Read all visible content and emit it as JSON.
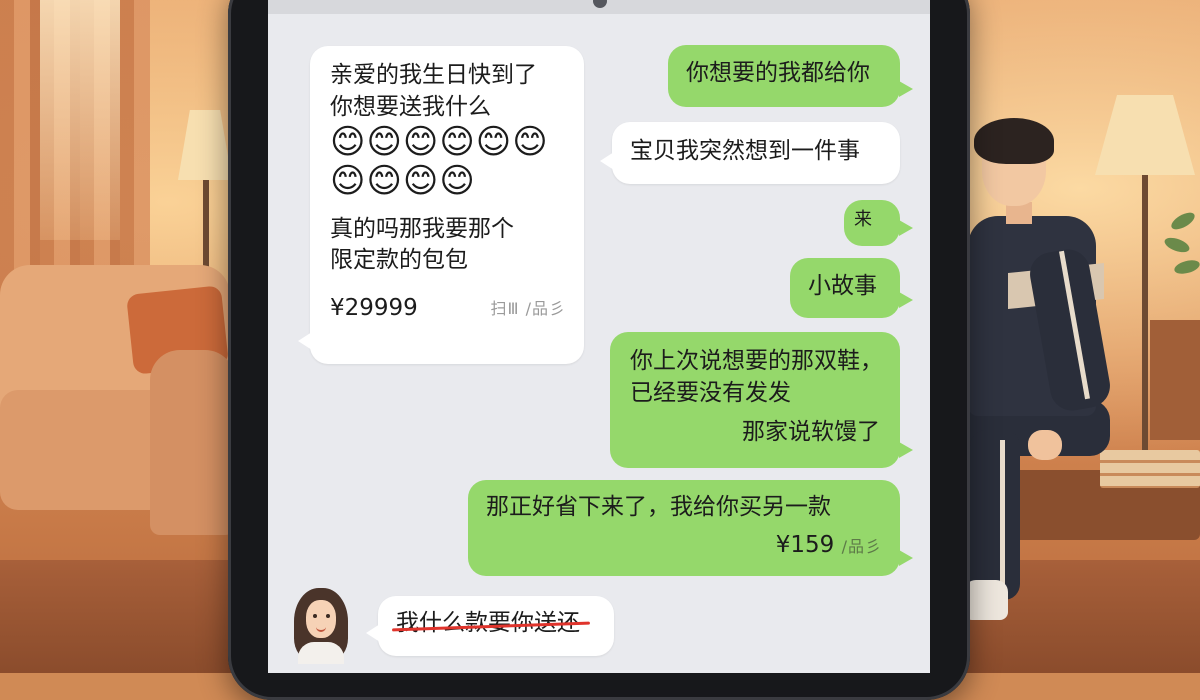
{
  "chat": {
    "incoming_1": {
      "line1": "亲爱的我生日快到了",
      "line2": "你想要送我什么",
      "emojis_row1": "😊😊😊😊😊😊",
      "emojis_row2": "😊😊😊😊",
      "line3": "真的吗那我要那个",
      "line4": "限定款的包包",
      "price": "¥29999",
      "scribble": "扫Ⅲ /品彡"
    },
    "outgoing_1": "你想要的我都给你",
    "outgoing_2": "宝贝我突然想到一件事",
    "outgoing_3": "来",
    "outgoing_4": "小故事",
    "outgoing_5": {
      "line1": "你上次说想要的那双鞋，",
      "line2": "已经要没有发发",
      "line3": "那家说软馒了"
    },
    "outgoing_6": {
      "line1": "那正好省下来了，我给你买另一款",
      "price": "¥159",
      "scribble": "/品彡"
    },
    "incoming_2": {
      "text": "我什么款要你送还"
    }
  },
  "colors": {
    "incoming_bubble": "#ffffff",
    "outgoing_bubble": "#95d86b",
    "strike_line": "#e0342c",
    "chat_background": "#e9eaee"
  }
}
